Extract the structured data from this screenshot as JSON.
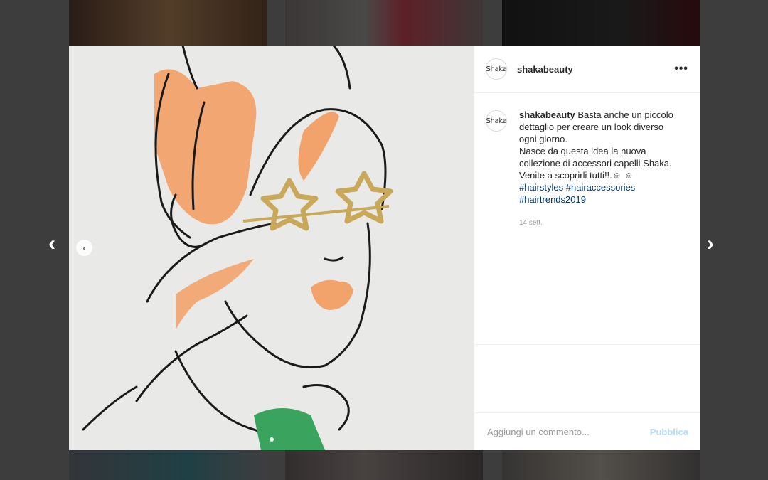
{
  "post": {
    "username": "shakabeauty",
    "avatar_text": "Shaka",
    "more_icon": "•••",
    "caption_lines": [
      "Basta anche un piccolo",
      "dettaglio per creare un look diverso",
      "ogni giorno.",
      "Nasce da questa idea la nuova",
      "collezione di accessori capelli Shaka.",
      "Venite a scoprirli tutti!!.☺ ☺"
    ],
    "hashtags": [
      "#hairstyles",
      "#hairaccessories",
      "#hairtrends2019"
    ],
    "timestamp": "14 sett.",
    "comment_placeholder": "Aggiungi un commento...",
    "publish_label": "Pubblica"
  },
  "nav": {
    "prev_arrow": "‹",
    "next_arrow": "›",
    "carousel_prev": "‹"
  },
  "colors": {
    "accent_link": "#003569",
    "publish_disabled": "#b3dbff",
    "orange_paint": "#f2a36c",
    "green_paint": "#3aa35e"
  }
}
